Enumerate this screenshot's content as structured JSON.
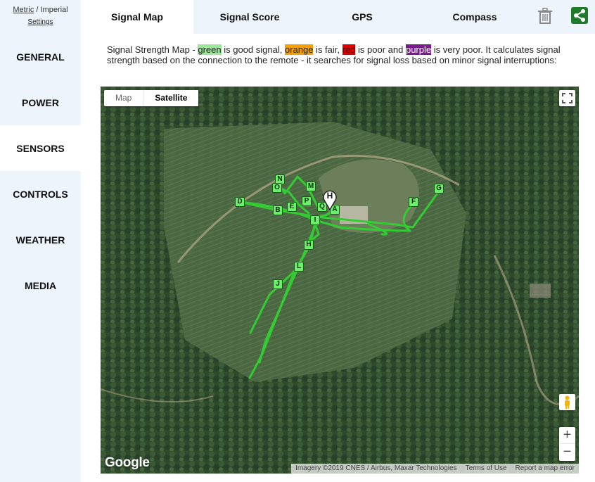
{
  "sidebar": {
    "units_metric": "Metric",
    "units_sep": " / ",
    "units_imperial": "Imperial",
    "settings": "Settings",
    "items": [
      {
        "label": "GENERAL"
      },
      {
        "label": "POWER"
      },
      {
        "label": "SENSORS"
      },
      {
        "label": "CONTROLS"
      },
      {
        "label": "WEATHER"
      },
      {
        "label": "MEDIA"
      }
    ],
    "active": "SENSORS"
  },
  "tabs": {
    "items": [
      {
        "label": "Signal Map"
      },
      {
        "label": "Signal Score"
      },
      {
        "label": "GPS"
      },
      {
        "label": "Compass"
      }
    ],
    "active": "Signal Map",
    "trash_icon": "trash-icon",
    "share_icon": "share-icon",
    "share_color": "#1f7a2c"
  },
  "description": {
    "p1": "Signal Strength Map - ",
    "green": "green",
    "p2": " is good signal, ",
    "orange": "orange",
    "p3": " is fair, ",
    "red": "red",
    "p4": " is poor and ",
    "purple": "purple",
    "p5": " is very poor. It calculates signal strength based on the connection to the remote - it searches for signal loss based on minor signal interruptions:",
    "colors": {
      "green": "#9be69b",
      "orange": "#f5a000",
      "red": "#e00000",
      "purple": "#7a1a8f"
    }
  },
  "map": {
    "type_map": "Map",
    "type_satellite": "Satellite",
    "selected_type": "Satellite",
    "logo": "Google",
    "imagery": "Imagery ©2019 CNES / Airbus, Maxar Technologies",
    "terms": "Terms of Use",
    "report": "Report a map error",
    "zoom_in": "+",
    "zoom_out": "−",
    "home_label": "H",
    "track_color": "#33cc33",
    "waypoints": [
      {
        "label": "N"
      },
      {
        "label": "O"
      },
      {
        "label": "M"
      },
      {
        "label": "D"
      },
      {
        "label": "B"
      },
      {
        "label": "E"
      },
      {
        "label": "P"
      },
      {
        "label": "Q"
      },
      {
        "label": "A"
      },
      {
        "label": "I"
      },
      {
        "label": "F"
      },
      {
        "label": "G"
      },
      {
        "label": "H"
      },
      {
        "label": "L"
      },
      {
        "label": "J"
      }
    ]
  }
}
